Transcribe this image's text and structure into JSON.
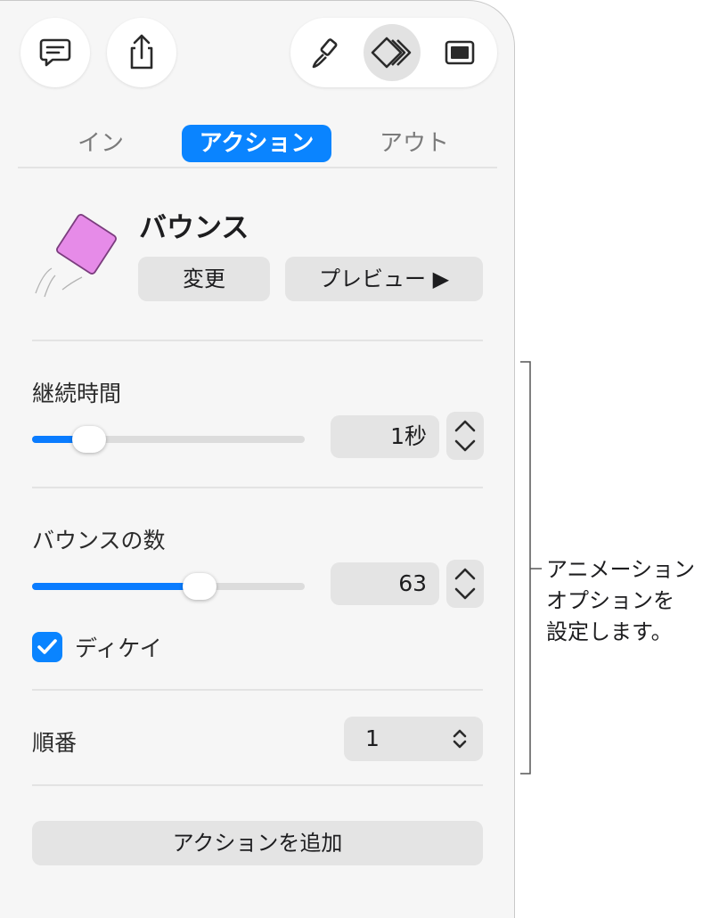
{
  "toolbar": {
    "comment_icon": "comment-icon",
    "share_icon": "share-icon",
    "format_icon": "paintbrush-icon",
    "animate_icon": "animate-diamond-icon",
    "document_icon": "document-icon"
  },
  "tabs": [
    {
      "label": "イン",
      "active": false
    },
    {
      "label": "アクション",
      "active": true
    },
    {
      "label": "アウト",
      "active": false
    }
  ],
  "effect": {
    "name": "バウンス",
    "change_label": "変更",
    "preview_label": "プレビュー ▶",
    "thumbnail_color": "#e68be8"
  },
  "duration": {
    "label": "継続時間",
    "value": "1秒",
    "slider_fraction": 0.21
  },
  "bounces": {
    "label": "バウンスの数",
    "value": "63",
    "slider_fraction": 0.61
  },
  "decay": {
    "label": "ディケイ",
    "checked": true
  },
  "order": {
    "label": "順番",
    "value": "1"
  },
  "add_action_label": "アクションを追加",
  "callout": {
    "line1": "アニメーション",
    "line2": "オプションを",
    "line3": "設定します。"
  },
  "colors": {
    "accent": "#0a84ff",
    "panel": "#f6f6f6"
  }
}
